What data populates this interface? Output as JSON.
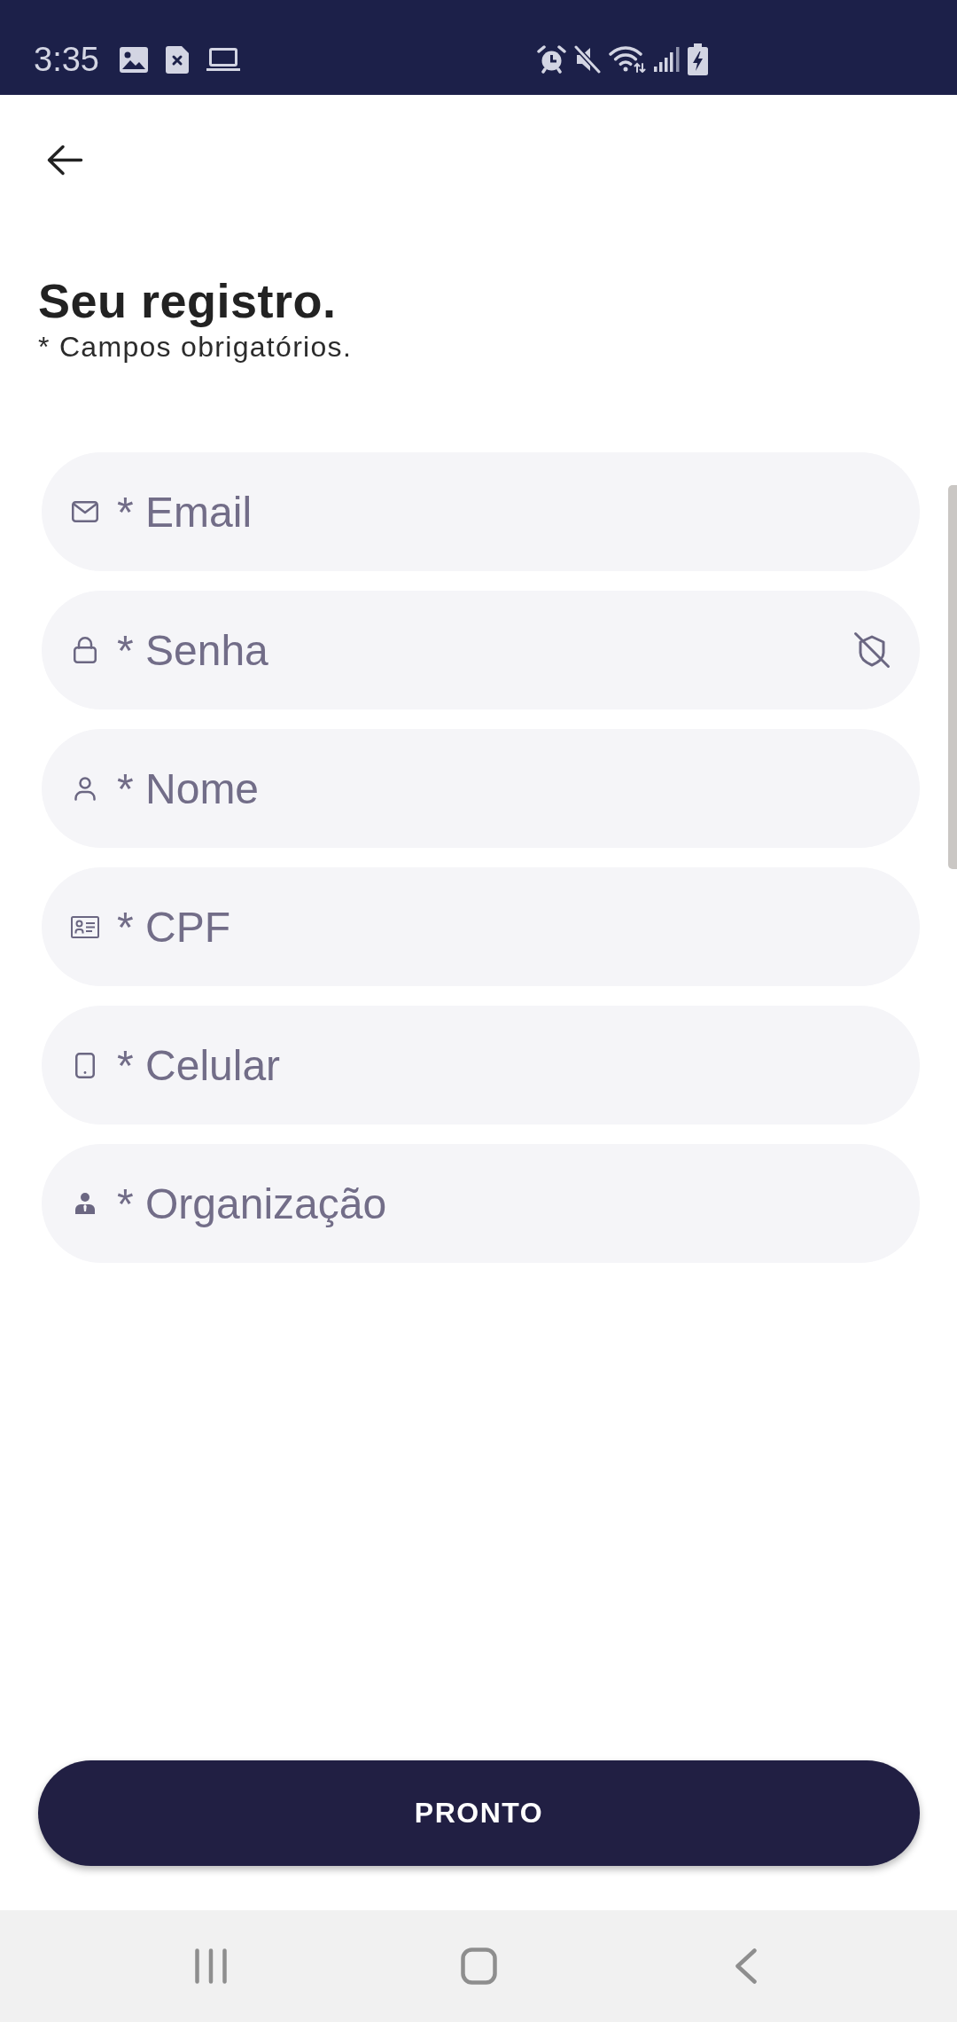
{
  "status_bar": {
    "time": "3:35"
  },
  "header": {
    "title": "Seu registro.",
    "subtitle": "* Campos obrigatórios."
  },
  "fields": [
    {
      "kind": "email",
      "placeholder": "* Email"
    },
    {
      "kind": "password",
      "placeholder": "* Senha"
    },
    {
      "kind": "name",
      "placeholder": "* Nome"
    },
    {
      "kind": "document",
      "placeholder": "* CPF"
    },
    {
      "kind": "phone",
      "placeholder": "* Celular"
    },
    {
      "kind": "organization",
      "placeholder": "* Organização"
    }
  ],
  "submit_button": {
    "label": "PRONTO"
  }
}
